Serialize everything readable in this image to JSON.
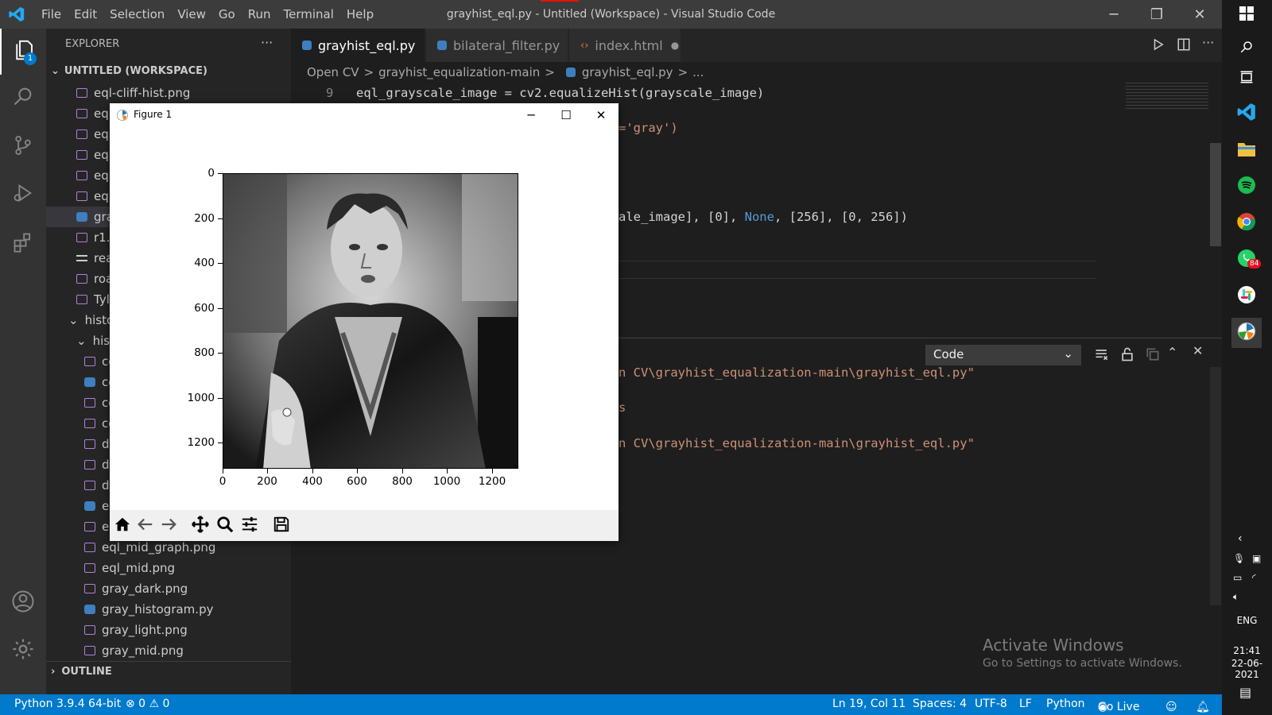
{
  "titlebar": {
    "menu": [
      "File",
      "Edit",
      "Selection",
      "View",
      "Go",
      "Run",
      "Terminal",
      "Help"
    ],
    "title": "grayhist_eql.py - Untitled (Workspace) - Visual Studio Code"
  },
  "activity": {
    "explorer_badge": "1"
  },
  "sidebar": {
    "header": "EXPLORER",
    "more": "···",
    "workspace": "UNTITLED (WORKSPACE)",
    "items": [
      "eql-cliff-hist.png",
      "eql",
      "eql",
      "eql",
      "eql",
      "eq",
      "gra",
      "r1.j",
      "rea",
      "roa",
      "Tyl",
      "histo",
      "his",
      "co",
      "co",
      "co",
      "co",
      "d",
      "d",
      "d",
      "e",
      "e",
      "eql_mid_graph.png",
      "eql_mid.png",
      "gray_dark.png",
      "gray_histogram.py",
      "gray_light.png",
      "gray_mid.png"
    ],
    "outline": "OUTLINE"
  },
  "tabs": [
    {
      "label": "grayhist_eql.py",
      "close": "✕"
    },
    {
      "label": "bilateral_filter.py"
    },
    {
      "label": "index.html",
      "dot": "●"
    }
  ],
  "breadcrumb": {
    "parts": [
      "Open CV",
      ">",
      "grayhist_equalization-main",
      ">",
      "grayhist_eql.py",
      ">",
      "..."
    ]
  },
  "editor": {
    "line_number": "9",
    "line9": "eql_grayscale_image = cv2.equalizeHist(grayscale_image)",
    "frag1": "='gray')",
    "frag2a": "ale_image], [0], ",
    "frag2b": "None",
    "frag2c": ", [256], [0, 256])"
  },
  "panel": {
    "dropdown": "Code",
    "lines": [
      "n CV\\grayhist_equalization-main\\grayhist_eql.py\"",
      "s",
      "n CV\\grayhist_equalization-main\\grayhist_eql.py\""
    ]
  },
  "watermark": {
    "title": "Activate Windows",
    "subtitle": "Go to Settings to activate Windows."
  },
  "statusbar": {
    "python": "Python 3.9.4 64-bit",
    "problems": "⊗ 0 ⚠ 0",
    "position": "Ln 19, Col 11",
    "spaces": "Spaces: 4",
    "encoding": "UTF-8",
    "eol": "LF",
    "language": "Python",
    "golive": "Go Live"
  },
  "taskbar": {
    "badge": "84",
    "lang": "ENG",
    "time": "21:41",
    "date": "22-06-2021"
  },
  "figure": {
    "title": "Figure 1",
    "y_ticks": [
      "0",
      "200",
      "400",
      "600",
      "800",
      "1000",
      "1200"
    ],
    "x_ticks": [
      "0",
      "200",
      "400",
      "600",
      "800",
      "1000",
      "1200"
    ]
  },
  "colors": {
    "accent": "#007acc",
    "string": "#ce9178",
    "keyword": "#569cd6",
    "number": "#b5cea8"
  }
}
